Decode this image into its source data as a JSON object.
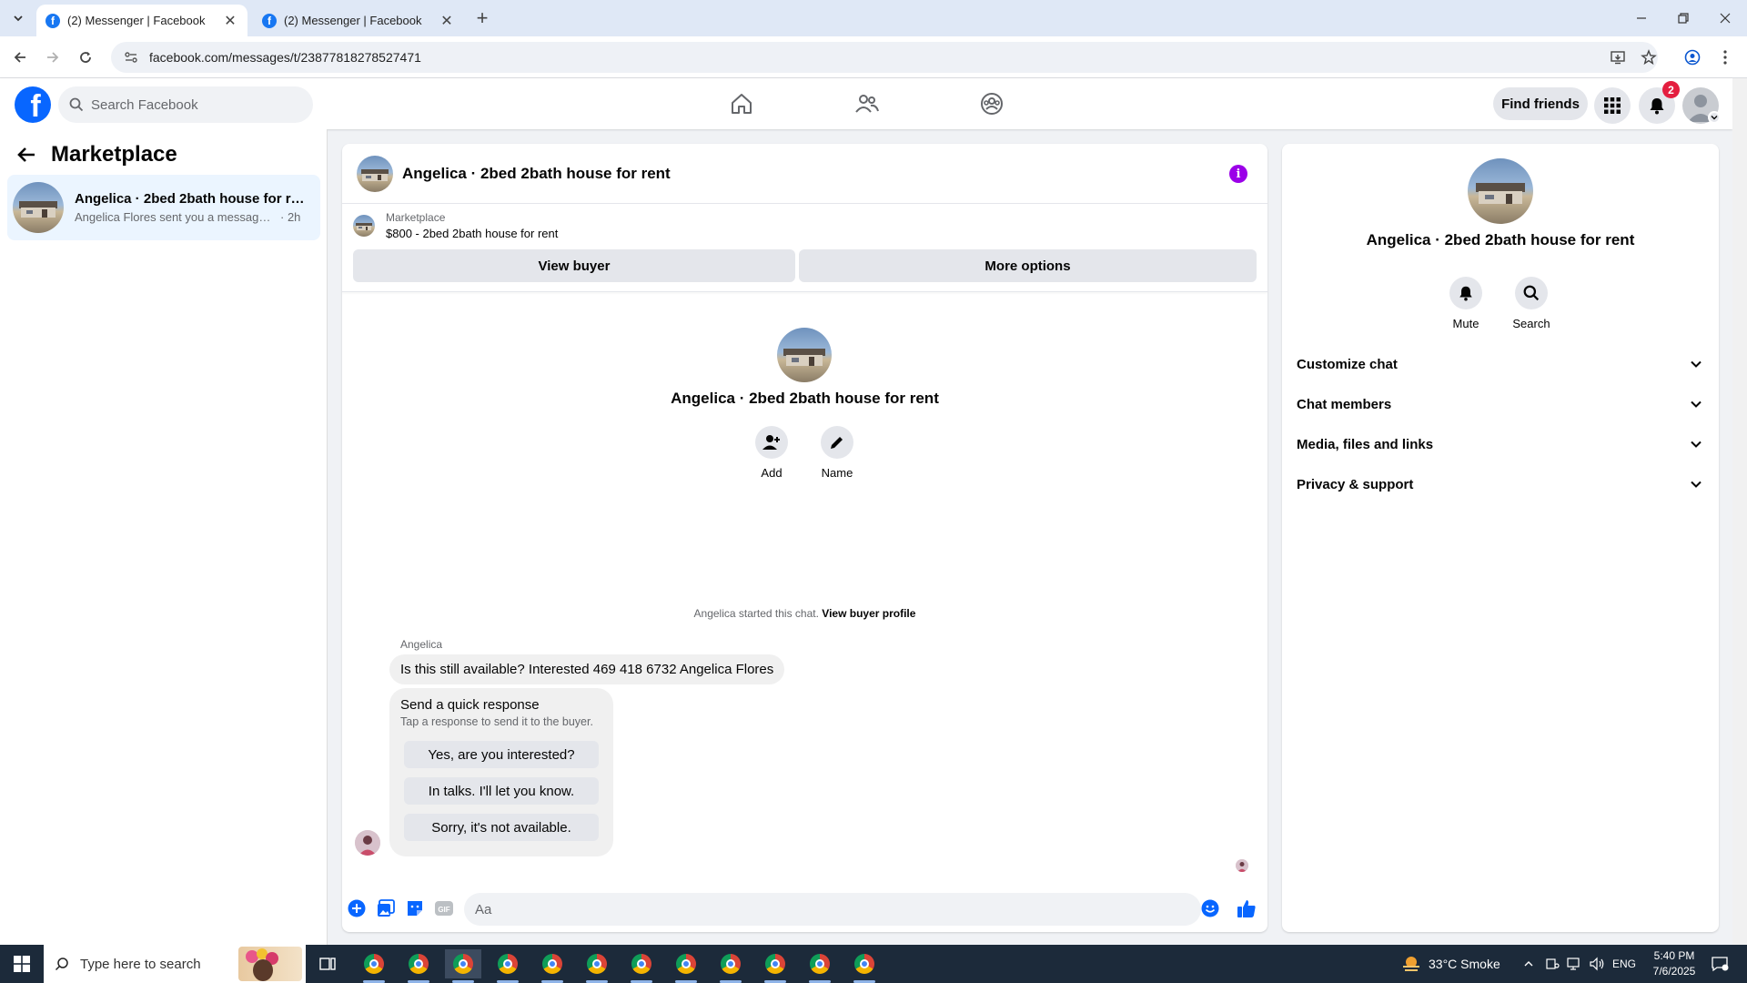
{
  "browser": {
    "tabs": [
      {
        "title": "(2) Messenger | Facebook",
        "favicon": "f"
      },
      {
        "title": "(2) Messenger | Facebook",
        "favicon": "f"
      }
    ],
    "url": "facebook.com/messages/t/23877818278527471"
  },
  "header": {
    "logo": "f",
    "search_placeholder": "Search Facebook",
    "find_friends": "Find friends",
    "notification_count": "2"
  },
  "sidebar": {
    "title": "Marketplace",
    "conversation": {
      "name": "Angelica · 2bed 2bath house for re...",
      "snippet": "Angelica Flores sent you a message a...",
      "time": "· 2h"
    }
  },
  "chat": {
    "title": "Angelica · 2bed 2bath house for rent",
    "info_icon": "i",
    "marketplace_label": "Marketplace",
    "listing": "$800 - 2bed 2bath house for rent",
    "view_buyer": "View buyer",
    "more_options": "More options",
    "intro_name": "Angelica · 2bed 2bath house for rent",
    "add_label": "Add",
    "name_label": "Name",
    "started_text": "Angelica started this chat.",
    "view_buyer_profile": "View buyer profile",
    "sender": "Angelica",
    "message": "Is this still available? Interested 469 418 6732 Angelica Flores",
    "quick_title": "Send a quick response",
    "quick_subtitle": "Tap a response to send it to the buyer.",
    "quick_responses": [
      "Yes, are you interested?",
      "In talks. I'll let you know.",
      "Sorry, it's not available."
    ],
    "input_placeholder": "Aa",
    "gif_label": "GIF"
  },
  "info_panel": {
    "name": "Angelica · 2bed 2bath house for rent",
    "mute": "Mute",
    "search": "Search",
    "sections": [
      "Customize chat",
      "Chat members",
      "Media, files and links",
      "Privacy & support"
    ]
  },
  "taskbar": {
    "search_placeholder": "Type here to search",
    "weather": "33°C  Smoke",
    "language": "ENG",
    "time": "5:40 PM",
    "date": "7/6/2025"
  },
  "colors": {
    "accent": "#0866ff",
    "info": "#9b00e8",
    "badge": "#e41e3f"
  }
}
